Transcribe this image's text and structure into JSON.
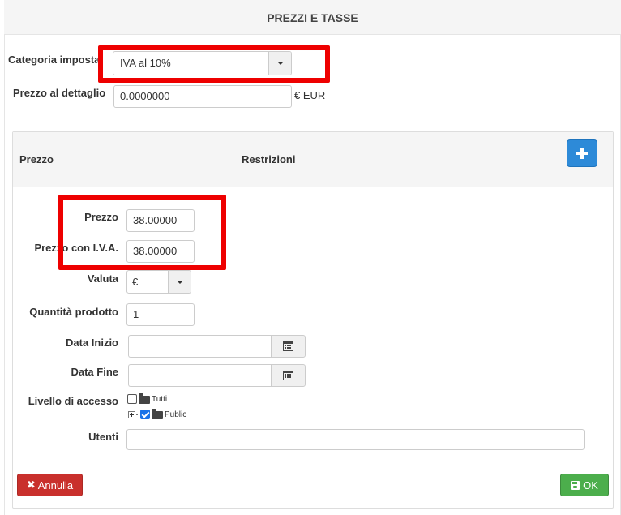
{
  "panel": {
    "title": "PREZZI E TASSE"
  },
  "tax": {
    "category_label": "Categoria imposta",
    "category_value": "IVA al 10%",
    "retail_label": "Prezzo al dettaglio",
    "retail_value": "0.0000000",
    "retail_currency": "€ EUR"
  },
  "prices_table": {
    "col_price": "Prezzo",
    "col_restrictions": "Restrizioni",
    "add_icon": "plus-icon"
  },
  "price_form": {
    "price_label": "Prezzo",
    "price_value": "38.00000",
    "price_vat_label": "Prezzo con I.V.A.",
    "price_vat_value": "38.00000",
    "currency_label": "Valuta",
    "currency_value": "€ EUR",
    "quantity_label": "Quantità prodotto",
    "quantity_value": "1",
    "start_label": "Data Inizio",
    "end_label": "Data Fine",
    "access_label": "Livello di accesso",
    "access_tree": [
      {
        "label": "Tutti",
        "checked": false
      },
      {
        "label": "Public",
        "checked": true
      }
    ],
    "users_label": "Utenti"
  },
  "actions": {
    "cancel_label": "Annulla",
    "ok_label": "OK",
    "cancel_color": "#c9302c",
    "ok_color": "#4cae4c"
  },
  "annotations": {
    "highlight_color": "#ee0000"
  }
}
